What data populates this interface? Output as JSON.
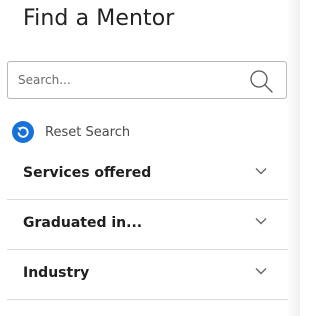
{
  "header": {
    "title": "Find a Mentor"
  },
  "search": {
    "placeholder": "Search...",
    "value": "",
    "icon": "search-icon"
  },
  "reset": {
    "label": "Reset Search",
    "icon": "reset-icon",
    "icon_color": "#1672d6"
  },
  "filters": [
    {
      "label": "Services offered",
      "icon": "chevron-down-icon"
    },
    {
      "label": "Graduated in...",
      "icon": "chevron-down-icon"
    },
    {
      "label": "Industry",
      "icon": "chevron-down-icon"
    }
  ]
}
